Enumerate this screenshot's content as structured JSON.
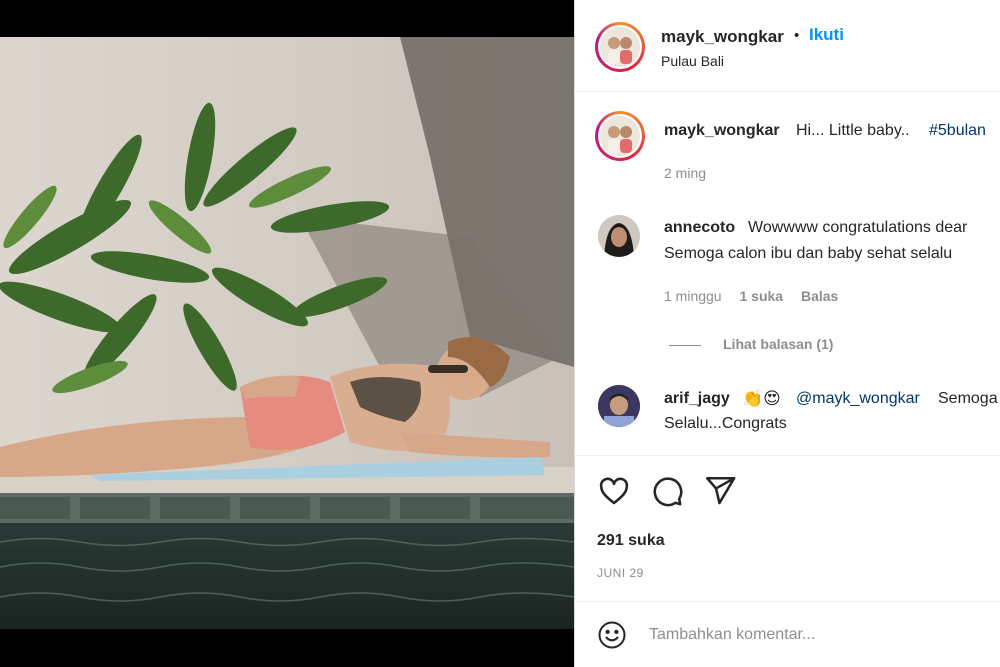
{
  "header": {
    "username": "mayk_wongkar",
    "separator": "•",
    "follow_label": "Ikuti",
    "location": "Pulau Bali"
  },
  "caption": {
    "username": "mayk_wongkar",
    "text": "Hi... Little baby..",
    "hashtag": "#5bulan",
    "time": "2 ming"
  },
  "comments": [
    {
      "username": "annecoto",
      "text_line1": "Wowwww congratulations dear",
      "text_line2": "Semoga calon ibu dan baby sehat selalu",
      "time": "1 minggu",
      "likes": "1 suka",
      "reply_label": "Balas",
      "view_replies": "Lihat balasan (1)"
    },
    {
      "username": "arif_jagy",
      "emoji": "👏😍",
      "mention": "@mayk_wongkar",
      "text_line1": "Semoga",
      "text_line2": "Selalu...Congrats"
    }
  ],
  "actions": {
    "like_icon": "heart-icon",
    "comment_icon": "comment-bubble-icon",
    "share_icon": "paper-plane-icon"
  },
  "likes_count": "291 suka",
  "date": "JUNI 29",
  "add_comment": {
    "emoji_icon": "smiley-icon",
    "placeholder": "Tambahkan komentar..."
  },
  "colors": {
    "link_blue": "#0095f6",
    "hashtag_blue": "#00376b",
    "muted_gray": "#8e8e8e"
  }
}
